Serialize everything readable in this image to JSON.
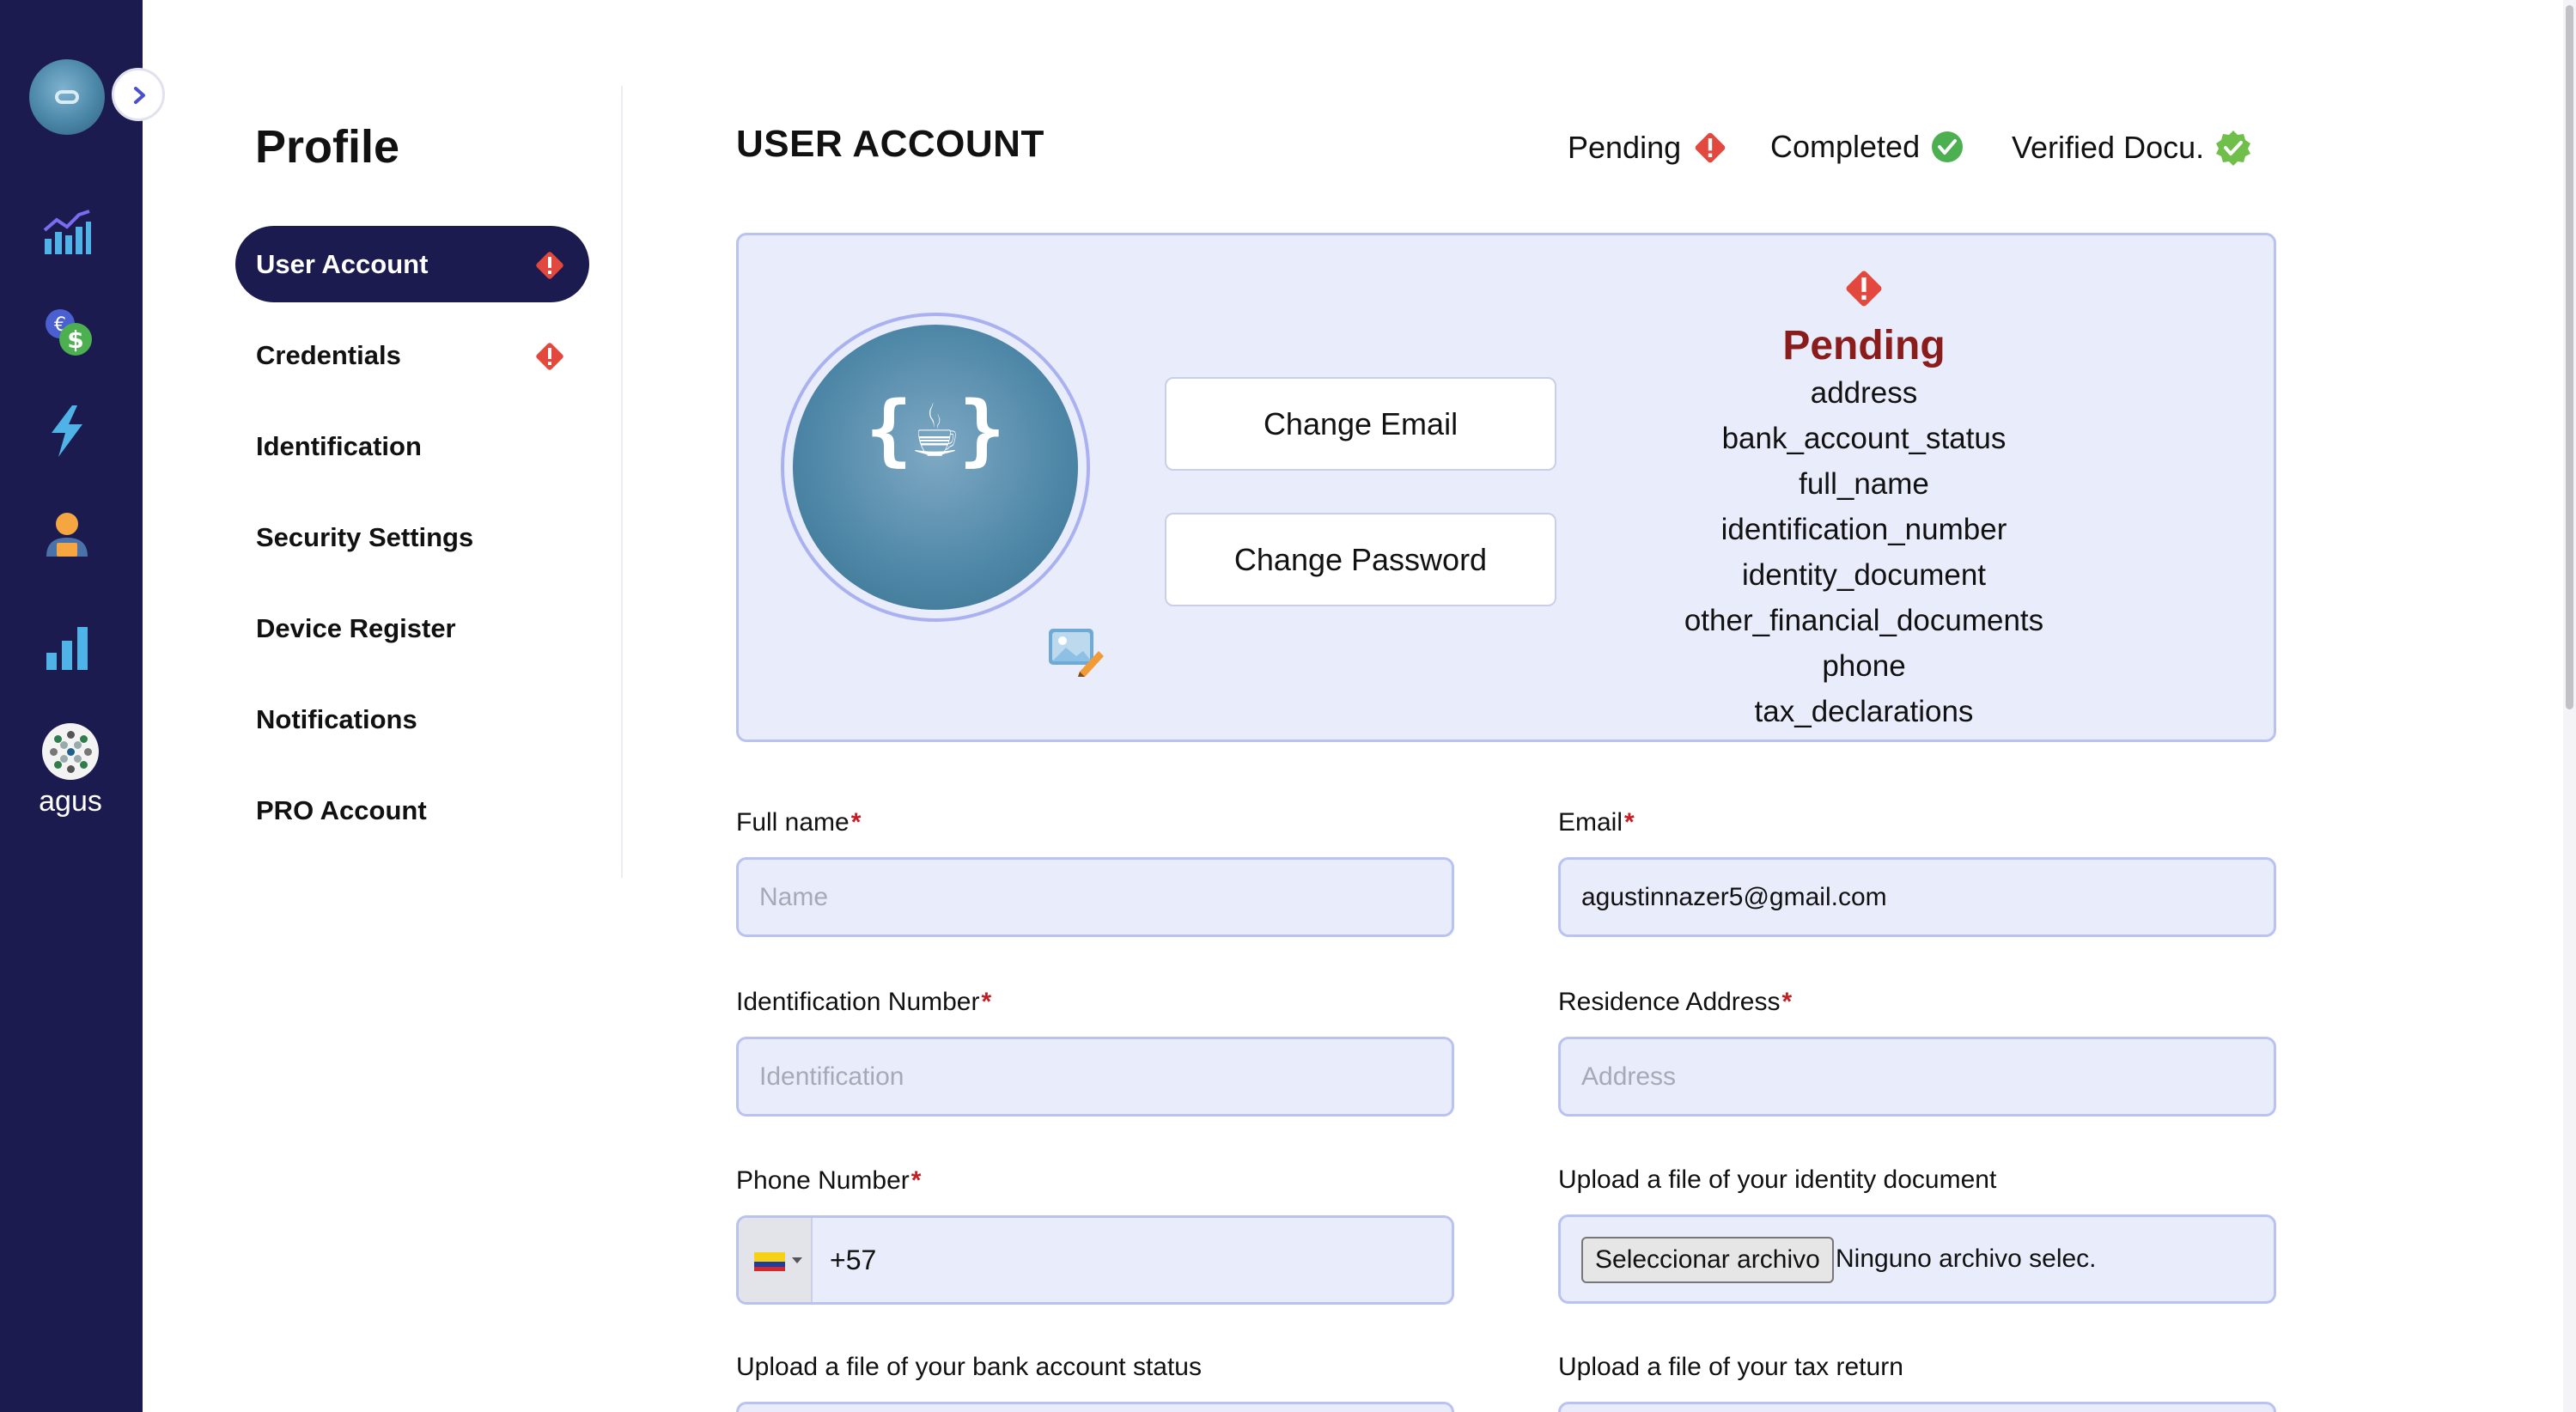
{
  "sidebar_rail": {
    "username": "agus",
    "icons": [
      "app-logo-icon",
      "analytics-chart-icon",
      "currency-exchange-icon",
      "lightning-icon",
      "user-account-icon",
      "bar-chart-icon",
      "user-avatar-icon"
    ]
  },
  "profile_nav": {
    "title": "Profile",
    "items": [
      {
        "label": "User Account",
        "active": true,
        "warning": true
      },
      {
        "label": "Credentials",
        "active": false,
        "warning": true
      },
      {
        "label": "Identification",
        "active": false,
        "warning": false
      },
      {
        "label": "Security Settings",
        "active": false,
        "warning": false
      },
      {
        "label": "Device Register",
        "active": false,
        "warning": false
      },
      {
        "label": "Notifications",
        "active": false,
        "warning": false
      },
      {
        "label": "PRO Account",
        "active": false,
        "warning": false
      }
    ]
  },
  "main": {
    "title": "USER ACCOUNT",
    "legend": {
      "pending": "Pending",
      "completed": "Completed",
      "verified": "Verified Docu."
    }
  },
  "summary_card": {
    "avatar_glyph": "{☕}",
    "change_email": "Change Email",
    "change_password": "Change Password",
    "pending_title": "Pending",
    "pending_items": [
      "address",
      "bank_account_status",
      "full_name",
      "identification_number",
      "identity_document",
      "other_financial_documents",
      "phone",
      "tax_declarations"
    ]
  },
  "form": {
    "full_name": {
      "label": "Full name",
      "required": "*",
      "placeholder": "Name",
      "value": ""
    },
    "email": {
      "label": "Email",
      "required": "*",
      "placeholder": "",
      "value": "agustinnazer5@gmail.com"
    },
    "identification_number": {
      "label": "Identification Number",
      "required": "*",
      "placeholder": "Identification",
      "value": ""
    },
    "residence_address": {
      "label": "Residence Address",
      "required": "*",
      "placeholder": "Address",
      "value": ""
    },
    "phone": {
      "label": "Phone Number",
      "required": "*",
      "country": "Colombia",
      "value": "+57"
    },
    "identity_document": {
      "label": "Upload a file of your identity document",
      "button": "Seleccionar archivo",
      "status": "Ninguno archivo selec."
    },
    "bank_account_status": {
      "label": "Upload a file of your bank account status"
    },
    "tax_return": {
      "label": "Upload a file of your tax return"
    }
  },
  "colors": {
    "rail_bg": "#1c1b4f",
    "active_nav_bg": "#1c1b4f",
    "card_bg": "#e9ecfb",
    "card_border": "#b9c2f0",
    "warning_red": "#e2483d",
    "success_green": "#4caf50",
    "pending_title": "#8b1c1c",
    "required_star": "#c41e24"
  }
}
